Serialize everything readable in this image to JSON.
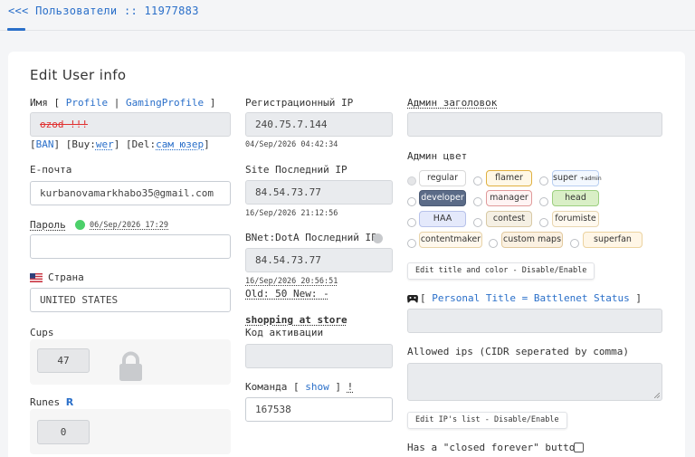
{
  "breadcrumb": {
    "back": "<<<",
    "section": "Пользователи",
    "sep": "::",
    "user_id": "11977883"
  },
  "page_title": "Edit User info",
  "name_field": {
    "label": "Имя",
    "bracket_open": "[",
    "profile_link": "Profile",
    "pipe": "|",
    "gaming_profile_link": "GamingProfile",
    "bracket_close": "]",
    "value": "ozod !!!"
  },
  "name_actions": {
    "ban": "BAN",
    "buy_label": "Buy:",
    "buy_link": "wer",
    "del_label": "Del:",
    "del_link": "сам юзер"
  },
  "email": {
    "label": "E-почта",
    "value": "kurbanovamarkhabo35@gmail.com"
  },
  "password": {
    "label": "Пароль",
    "date": "06/Sep/2026 17:29",
    "value": ""
  },
  "country": {
    "label": "Страна",
    "value": "UNITED STATES"
  },
  "cups": {
    "label": "Cups",
    "value": "47"
  },
  "runes": {
    "label": "Runes",
    "icon_char": "R",
    "value": "0"
  },
  "reg_ip": {
    "label": "Регистрационный IP",
    "value": "240.75.7.144",
    "date": "04/Sep/2026 04:42:34"
  },
  "site_ip": {
    "label": "Site Последний IP",
    "value": "84.54.73.77",
    "date": "16/Sep/2026 21:12:56"
  },
  "bnet_ip": {
    "label": "BNet:DotA Последний IP",
    "value": "84.54.73.77",
    "date": "16/Sep/2026 20:56:51",
    "old_new": "Old: 50 New: -"
  },
  "shopping": {
    "link": "shopping at store"
  },
  "activation": {
    "label": "Код активации",
    "value": ""
  },
  "team": {
    "label": "Команда",
    "bracket_open": "[",
    "show_link": "show",
    "bracket_close": "]",
    "excl": "!",
    "value": "167538"
  },
  "admin_header": {
    "label": "Админ заголовок",
    "value": ""
  },
  "admin_color": {
    "label": "Админ цвет",
    "chips": [
      {
        "label": "regular",
        "bg": "#ffffff",
        "border": "#d8d8d8",
        "color": "#333333",
        "checked": true
      },
      {
        "label": "flamer",
        "bg": "#fff8e6",
        "border": "#e0b040",
        "color": "#333333"
      },
      {
        "label": "super",
        "sub": "+admin",
        "bg": "#f3f8ff",
        "border": "#b8cef0",
        "color": "#333333"
      },
      {
        "label": "developer",
        "bg": "#5b6b87",
        "border": "#4b5a75",
        "color": "#ffffff"
      },
      {
        "label": "manager",
        "bg": "#fff4f4",
        "border": "#e09a9a",
        "color": "#333333"
      },
      {
        "label": "head",
        "bg": "#d9efc6",
        "border": "#9ccf80",
        "color": "#333333"
      },
      {
        "label": "HAA",
        "bg": "#e4e9fb",
        "border": "#b7c2ea",
        "color": "#333333"
      },
      {
        "label": "contest",
        "bg": "#f5f0e4",
        "border": "#d8c9a4",
        "color": "#333333"
      },
      {
        "label": "forumiste",
        "bg": "#fff9ef",
        "border": "#e8d6b0",
        "color": "#333333"
      },
      {
        "label": "contentmaker",
        "bg": "#fff8ed",
        "border": "#e8d3a8",
        "color": "#333333"
      },
      {
        "label": "custom maps",
        "bg": "#fbf1e2",
        "border": "#e2c99e",
        "color": "#333333"
      },
      {
        "label": "superfan",
        "bg": "#fff6e6",
        "border": "#ecd3a0",
        "color": "#333333"
      }
    ]
  },
  "title_color_btn": "Edit title and color - Disable/Enable",
  "personal_title": {
    "bracket_open": "[",
    "link": "Personal Title = Battlenet Status",
    "bracket_close": "]",
    "value": ""
  },
  "allowed_ips": {
    "label": "Allowed ips (CIDR seperated by comma)",
    "value": ""
  },
  "ips_btn": "Edit IP's list - Disable/Enable",
  "closed_forever": {
    "label": "Has a \"closed forever\" button"
  },
  "colors": {
    "accent": "#2a6fc9",
    "online": "#4cd06a",
    "struck": "#e03030"
  }
}
